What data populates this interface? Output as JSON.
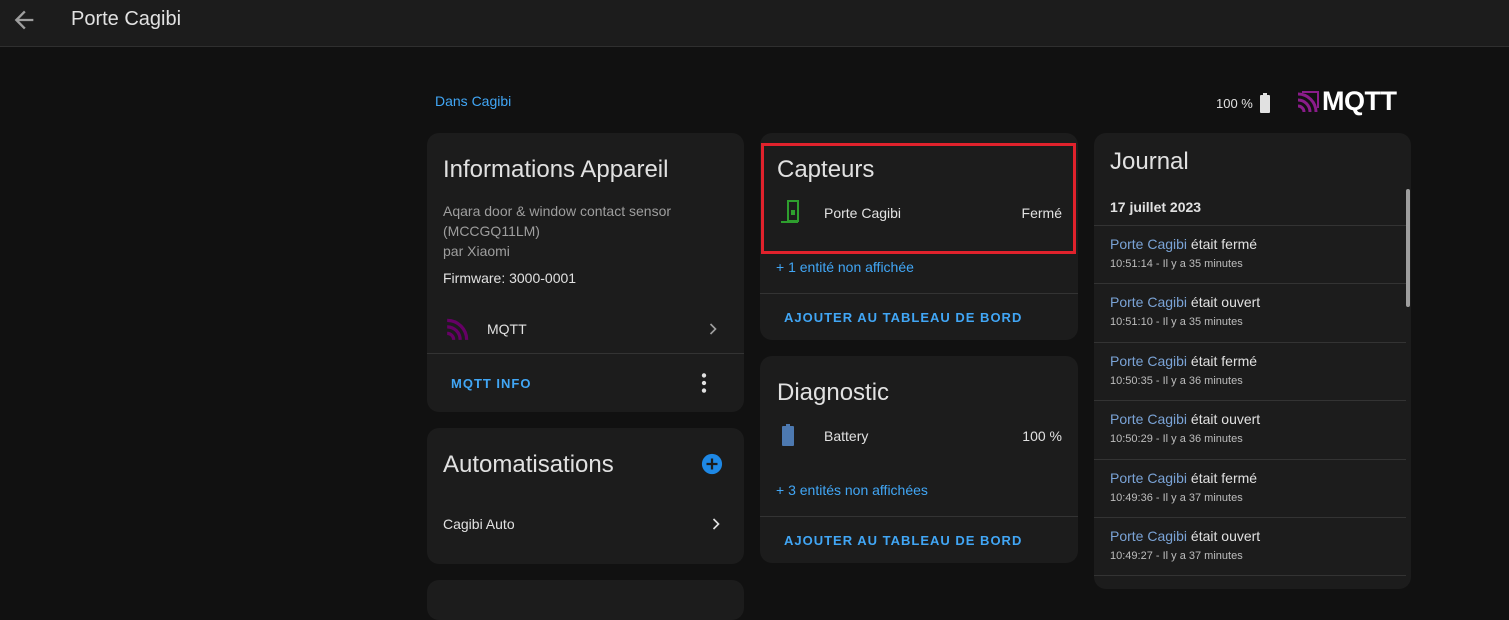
{
  "header": {
    "title": "Porte Cagibi"
  },
  "area_link": "Dans Cagibi",
  "battery_level": "100 %",
  "integration_logo": "MQTT",
  "device_info": {
    "title": "Informations Appareil",
    "model_line1": "Aqara door & window contact sensor",
    "model_line2": "(MCCGQ11LM)",
    "manufacturer": "par Xiaomi",
    "firmware": "Firmware: 3000-0001",
    "integration_label": "MQTT",
    "action": "MQTT INFO"
  },
  "automations": {
    "title": "Automatisations",
    "items": [
      {
        "label": "Cagibi Auto"
      }
    ]
  },
  "sensors": {
    "title": "Capteurs",
    "entity_name": "Porte Cagibi",
    "entity_state": "Fermé",
    "hidden_link": "+ 1 entité non affichée",
    "action": "AJOUTER AU TABLEAU DE BORD"
  },
  "diagnostic": {
    "title": "Diagnostic",
    "entity_name": "Battery",
    "entity_state": "100 %",
    "hidden_link": "+ 3 entités non affichées",
    "action": "AJOUTER AU TABLEAU DE BORD"
  },
  "journal": {
    "title": "Journal",
    "date": "17 juillet 2023",
    "entries": [
      {
        "entity": "Porte Cagibi",
        "message": " était fermé",
        "time": "10:51:14 - Il y a 35 minutes"
      },
      {
        "entity": "Porte Cagibi",
        "message": " était ouvert",
        "time": "10:51:10 - Il y a 35 minutes"
      },
      {
        "entity": "Porte Cagibi",
        "message": " était fermé",
        "time": "10:50:35 - Il y a 36 minutes"
      },
      {
        "entity": "Porte Cagibi",
        "message": " était ouvert",
        "time": "10:50:29 - Il y a 36 minutes"
      },
      {
        "entity": "Porte Cagibi",
        "message": " était fermé",
        "time": "10:49:36 - Il y a 37 minutes"
      },
      {
        "entity": "Porte Cagibi",
        "message": " était ouvert",
        "time": "10:49:27 - Il y a 37 minutes"
      }
    ]
  },
  "colors": {
    "accent": "#41a6f5",
    "highlight": "#e0222c",
    "mqtt_purple": "#660066",
    "sensor_green": "#2e9e2e"
  },
  "icons": [
    "arrow-left-icon",
    "battery-icon",
    "mqtt-icon",
    "chevron-right-icon",
    "dots-vertical-icon",
    "plus-circle-icon",
    "door-sensor-icon",
    "battery-full-icon"
  ]
}
